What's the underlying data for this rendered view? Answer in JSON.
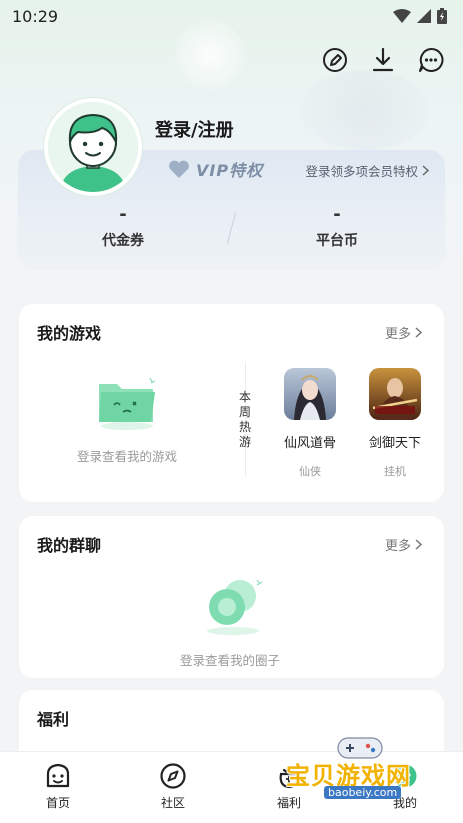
{
  "status_bar": {
    "time": "10:29"
  },
  "header": {
    "login_label": "登录/注册",
    "vip_badge": "VIP特权",
    "vip_link": "登录领多项会员特权",
    "stats": [
      {
        "value": "-",
        "label": "代金券"
      },
      {
        "value": "-",
        "label": "平台币"
      }
    ]
  },
  "my_games": {
    "title": "我的游戏",
    "more": "更多",
    "empty_text": "登录查看我的游戏",
    "hot_label": "本周热游",
    "games": [
      {
        "name": "仙风道骨",
        "tag": "仙侠"
      },
      {
        "name": "剑御天下",
        "tag": "挂机"
      }
    ]
  },
  "my_groups": {
    "title": "我的群聊",
    "more": "更多",
    "empty_text": "登录查看我的圈子"
  },
  "welfare": {
    "title": "福利"
  },
  "bottom_nav": [
    {
      "label": "首页",
      "icon": "home-icon"
    },
    {
      "label": "社区",
      "icon": "compass-icon"
    },
    {
      "label": "福利",
      "icon": "gift-icon"
    },
    {
      "label": "我的",
      "icon": "profile-icon"
    }
  ],
  "watermark": {
    "text": "宝贝游戏网",
    "url": "baobeiy.com"
  },
  "colors": {
    "accent": "#3ec28a",
    "vip": "#7d8ea6",
    "background": "#f3f4f6"
  }
}
